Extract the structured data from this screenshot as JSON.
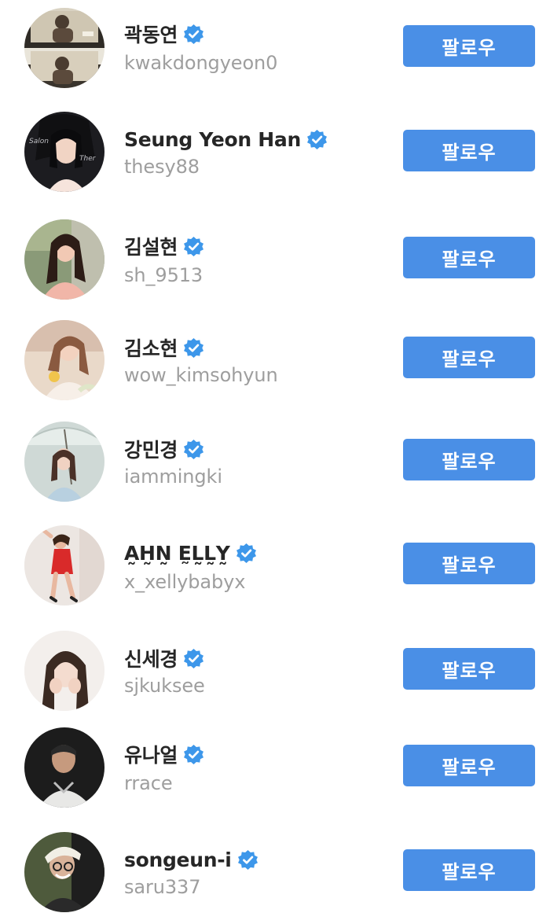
{
  "colors": {
    "accent": "#4a8fe6",
    "verified_badge": "#3d97ea",
    "name_text": "#262626",
    "handle_text": "#9e9e9e"
  },
  "follow_label": "팔로우",
  "accounts": [
    {
      "name": "곽동연",
      "handle": "kwakdongyeon0",
      "verified": true,
      "follow_label": "팔로우"
    },
    {
      "name": "Seung Yeon Han",
      "handle": "thesy88",
      "verified": true,
      "follow_label": "팔로우"
    },
    {
      "name": "김설현",
      "handle": "sh_9513",
      "verified": true,
      "follow_label": "팔로우"
    },
    {
      "name": "김소현",
      "handle": "wow_kimsohyun",
      "verified": true,
      "follow_label": "팔로우"
    },
    {
      "name": "강민경",
      "handle": "iammingki",
      "verified": true,
      "follow_label": "팔로우"
    },
    {
      "name": "A̰H̰N̰ ḚL̰L̰Y̰",
      "handle": "x_xellybabyx",
      "verified": true,
      "follow_label": "팔로우"
    },
    {
      "name": "신세경",
      "handle": "sjkuksee",
      "verified": true,
      "follow_label": "팔로우"
    },
    {
      "name": "유나얼",
      "handle": "rrace",
      "verified": true,
      "follow_label": "팔로우"
    },
    {
      "name": "songeun-i",
      "handle": "saru337",
      "verified": true,
      "follow_label": "팔로우"
    }
  ]
}
